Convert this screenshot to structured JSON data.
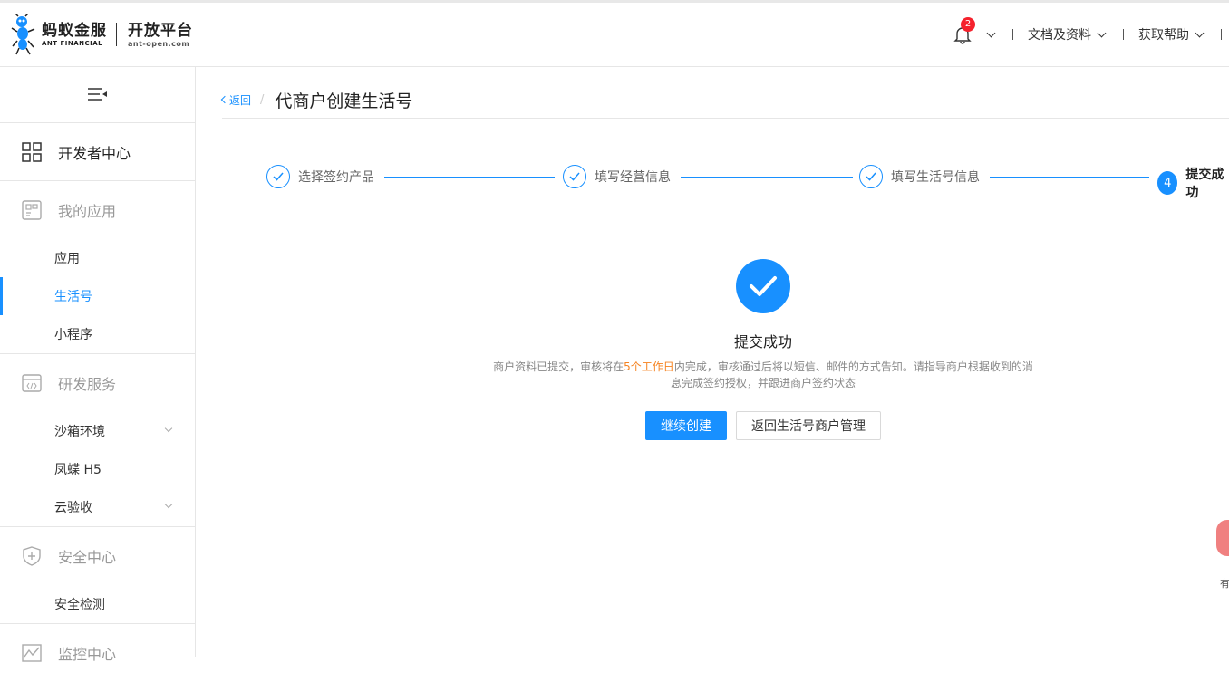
{
  "header": {
    "brand_cn": "蚂蚁金服",
    "brand_en": "ANT FINANCIAL",
    "platform_cn": "开放平台",
    "platform_en": "ant-open.com",
    "notification_count": "2",
    "menu_docs": "文档及资料",
    "menu_help": "获取帮助"
  },
  "sidebar": {
    "developer_center": "开发者中心",
    "groups": [
      {
        "label": "我的应用",
        "items": [
          "应用",
          "生活号",
          "小程序"
        ]
      },
      {
        "label": "研发服务",
        "items": [
          "沙箱环境",
          "凤蝶 H5",
          "云验收"
        ]
      },
      {
        "label": "安全中心",
        "items": [
          "安全检测"
        ]
      },
      {
        "label": "监控中心",
        "items": []
      }
    ],
    "active_item": "生活号"
  },
  "breadcrumb": {
    "back": "返回",
    "separator": "/",
    "title": "代商户创建生活号"
  },
  "steps": [
    {
      "label": "选择签约产品",
      "status": "done"
    },
    {
      "label": "填写经营信息",
      "status": "done"
    },
    {
      "label": "填写生活号信息",
      "status": "done"
    },
    {
      "number": "4",
      "label": "提交成功",
      "status": "current"
    }
  ],
  "result": {
    "title": "提交成功",
    "desc_before": "商户资料已提交，审核将在",
    "desc_highlight": "5个工作日",
    "desc_after": "内完成，审核通过后将以短信、邮件的方式告知。请指导商户根据收到的消息完成签约授权，并跟进商户签约状态",
    "btn_continue": "继续创建",
    "btn_back_manage": "返回生活号商户管理"
  },
  "floating": {
    "label": "有"
  },
  "colors": {
    "primary": "#1890ff",
    "highlight": "#f5821f",
    "badge": "#f5222d"
  }
}
